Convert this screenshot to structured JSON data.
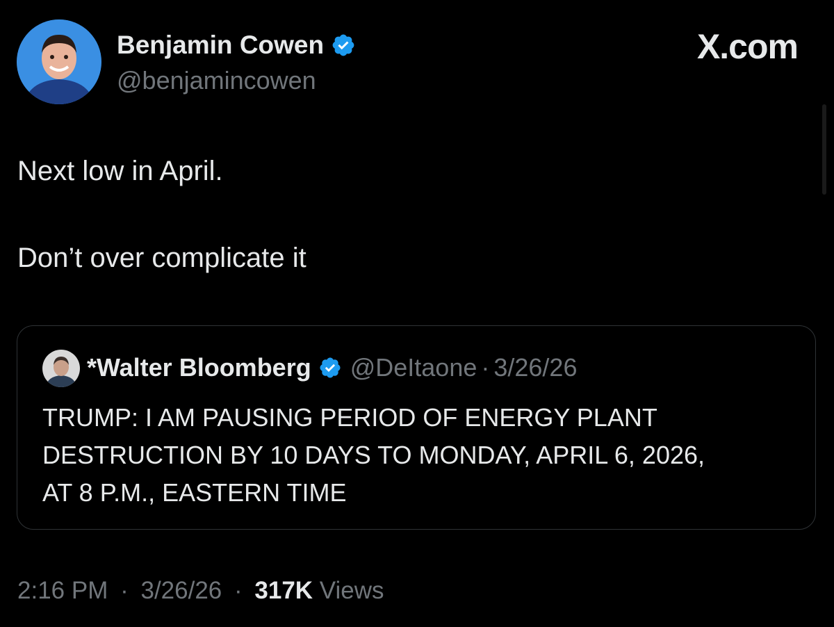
{
  "author": {
    "display_name": "Benjamin Cowen",
    "handle": "@benjamincowen",
    "avatar_icon": "user-avatar-icon",
    "verified_icon": "verified-badge-icon"
  },
  "brand": {
    "label": "X.com"
  },
  "tweet": {
    "lines": [
      "Next low in April.",
      "Don’t over complicate it"
    ]
  },
  "quote": {
    "display_name": "*Walter Bloomberg",
    "handle": "@DeItaone",
    "separator": "·",
    "date": "3/26/26",
    "body_lines": [
      "TRUMP: I AM PAUSING PERIOD OF ENERGY PLANT",
      "DESTRUCTION BY 10 DAYS TO MONDAY, APRIL 6, 2026,",
      "AT 8 P.M., EASTERN TIME"
    ]
  },
  "meta": {
    "time": "2:16 PM",
    "separator": "·",
    "date": "3/26/26",
    "views_count": "317K",
    "views_label": "Views"
  },
  "colors": {
    "background": "#000000",
    "text_primary": "#e7e9ea",
    "text_secondary": "#71767b",
    "verified": "#1d9bf0",
    "border": "#2f3336"
  }
}
